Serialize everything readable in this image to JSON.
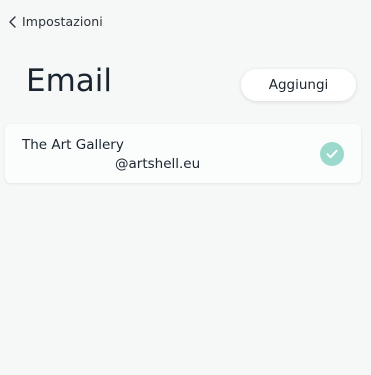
{
  "nav": {
    "back_label": "Impostazioni",
    "back_icon": "chevron-left-icon"
  },
  "header": {
    "title": "Email",
    "add_label": "Aggiungi"
  },
  "accounts": [
    {
      "name": "The Art Gallery",
      "address": "@artshell.eu",
      "verified": true,
      "status_icon": "check-circle-icon"
    }
  ],
  "colors": {
    "background": "#f6f8f7",
    "accent": "#9ad9cc",
    "text": "#1b2530"
  }
}
